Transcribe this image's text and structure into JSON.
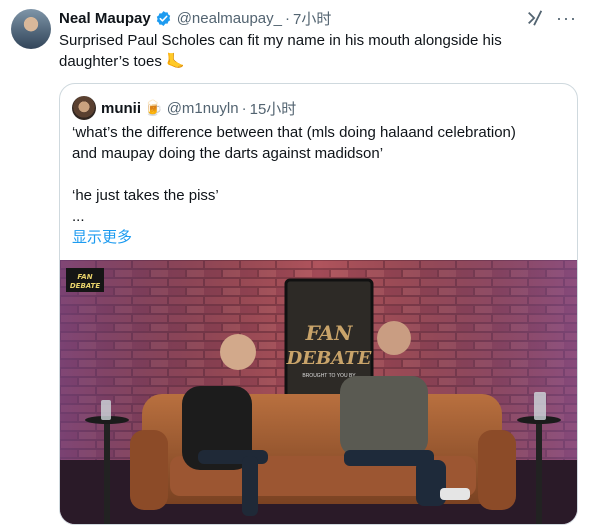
{
  "tweet": {
    "author_name": "Neal Maupay",
    "handle": "@nealmaupay_",
    "separator": "·",
    "time": "7小时",
    "text": "Surprised Paul Scholes can fit my name in his mouth alongside his daughter’s toes 🦶",
    "verified_color": "#1d9bf0"
  },
  "icons": {
    "grok": "grok-icon",
    "more": "more-icon",
    "verified": "verified-badge-icon"
  },
  "quote": {
    "author_name": "munii",
    "emoji": "🍺",
    "handle": "@m1nuyln",
    "separator": "·",
    "time": "15小时",
    "lines": [
      "‘what’s the difference between that (mls doing halaand celebration)",
      "and maupay doing the darts against madidson’",
      "",
      "‘he just takes the piss’",
      "..."
    ],
    "show_more": "显示更多",
    "media": {
      "logo_line1": "FAN",
      "logo_line2": "DEBATE",
      "backdrop_word1": "FAN",
      "backdrop_word2": "DEBATE",
      "backdrop_small": "BROUGHT TO YOU BY"
    }
  }
}
